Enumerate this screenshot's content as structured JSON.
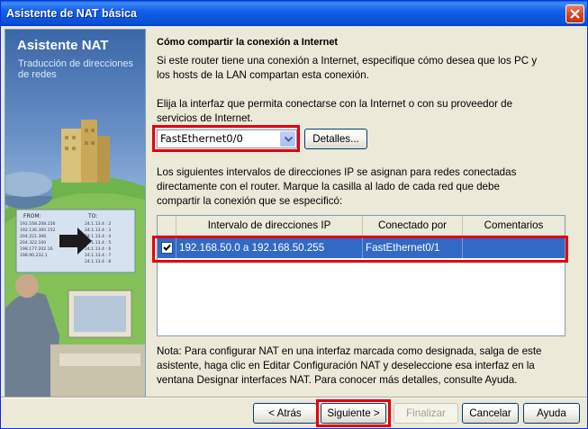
{
  "window": {
    "title": "Asistente de NAT básica"
  },
  "banner": {
    "title": "Asistente NAT",
    "subtitle": "Traducción de direcciones de redes",
    "art_table": {
      "col_from": "FROM:",
      "col_to": "TO:",
      "rows": [
        [
          "192.168.208.156",
          "24.1.13.4 : 2"
        ],
        [
          "192.136.300.152",
          "24.1.13.4 : 3"
        ],
        [
          "204.221.306",
          "24.1.13.4 : 4"
        ],
        [
          "204.322.100",
          "24.1.13.4 : 5"
        ],
        [
          "198.177.202.16",
          "24.1.13.4 : 6"
        ],
        [
          "198.90.232.1",
          "24.1.13.4 : 7"
        ],
        [
          "",
          "24.1.13.4 : 8"
        ]
      ]
    }
  },
  "main": {
    "heading": "Cómo compartir la conexión a Internet",
    "intro_line1": "Si este router tiene una conexión a Internet, especifique cómo desea que los PC y",
    "intro_line2": "los hosts de la LAN compartan esta conexión.",
    "choose_line1": "Elija la interfaz que permita conectarse con la Internet o con su proveedor de",
    "choose_line2": "servicios de Internet.",
    "interface_value": "FastEthernet0/0",
    "details_button": "Detalles...",
    "ranges_line1": "Los siguientes intervalos de direcciones IP se asignan para redes conectadas",
    "ranges_line2": "directamente con el router. Marque la casilla al lado de cada red que debe",
    "ranges_line3": "compartir la conexión que se especificó:",
    "table": {
      "columns": [
        "Intervalo de direcciones IP",
        "Conectado por",
        "Comentarios"
      ],
      "rows": [
        {
          "checked": true,
          "range": "192.168.50.0 a 192.168.50.255",
          "connected_by": "FastEthernet0/1",
          "comments": ""
        }
      ]
    },
    "note_line1": "Nota: Para configurar NAT en una interfaz marcada como designada, salga de este",
    "note_line2": "asistente, haga clic en Editar Configuración NAT y deseleccione esa interfaz en la",
    "note_line3": "ventana Designar interfaces NAT. Para conocer más detalles, consulte Ayuda."
  },
  "buttons": {
    "back": "< Atrás",
    "next": "Siguiente >",
    "finish": "Finalizar",
    "cancel": "Cancelar",
    "help": "Ayuda"
  },
  "colors": {
    "highlight": "#e00012",
    "selection": "#316ac5",
    "titlebar": "#0550d8"
  }
}
